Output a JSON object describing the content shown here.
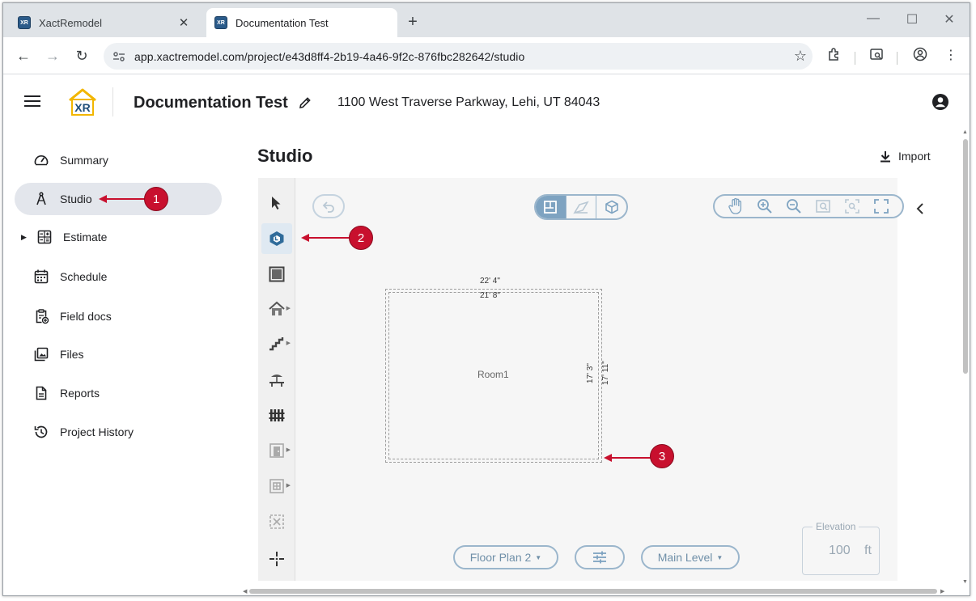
{
  "browser": {
    "tabs": [
      {
        "title": "XactRemodel",
        "favicon": "XR"
      },
      {
        "title": "Documentation Test",
        "favicon": "XR"
      }
    ],
    "new_tab": "+",
    "url": "app.xactremodel.com/project/e43d8ff4-2b19-4a46-9f2c-876fbc282642/studio",
    "window_controls": [
      "minimize-icon",
      "maximize-icon",
      "close-icon"
    ]
  },
  "header": {
    "project_title": "Documentation Test",
    "address": "1100 West Traverse Parkway, Lehi, UT 84043",
    "logo_text": "XR"
  },
  "sidebar": {
    "items": [
      {
        "label": "Summary",
        "icon": "gauge-icon"
      },
      {
        "label": "Studio",
        "icon": "compass-icon",
        "active": true
      },
      {
        "label": "Estimate",
        "icon": "calculator-icon",
        "expandable": true
      },
      {
        "label": "Schedule",
        "icon": "calendar-icon"
      },
      {
        "label": "Field docs",
        "icon": "clipboard-add-icon"
      },
      {
        "label": "Files",
        "icon": "photo-library-icon"
      },
      {
        "label": "Reports",
        "icon": "document-icon"
      },
      {
        "label": "Project History",
        "icon": "history-icon"
      }
    ]
  },
  "main": {
    "title": "Studio",
    "import_label": "Import"
  },
  "studio": {
    "room": {
      "name": "Room1",
      "outer_width": "22' 4\"",
      "inner_width": "21' 8\"",
      "inner_height": "17' 3\"",
      "outer_height": "17' 11\""
    },
    "floor_plan": "Floor Plan 2",
    "level": "Main Level",
    "elevation": {
      "label": "Elevation",
      "value": "100",
      "unit": "ft"
    }
  },
  "callouts": [
    "1",
    "2",
    "3"
  ],
  "colors": {
    "accent": "#7ea3c1",
    "callout": "#c8102e",
    "active_nav": "#e3e6ec"
  }
}
